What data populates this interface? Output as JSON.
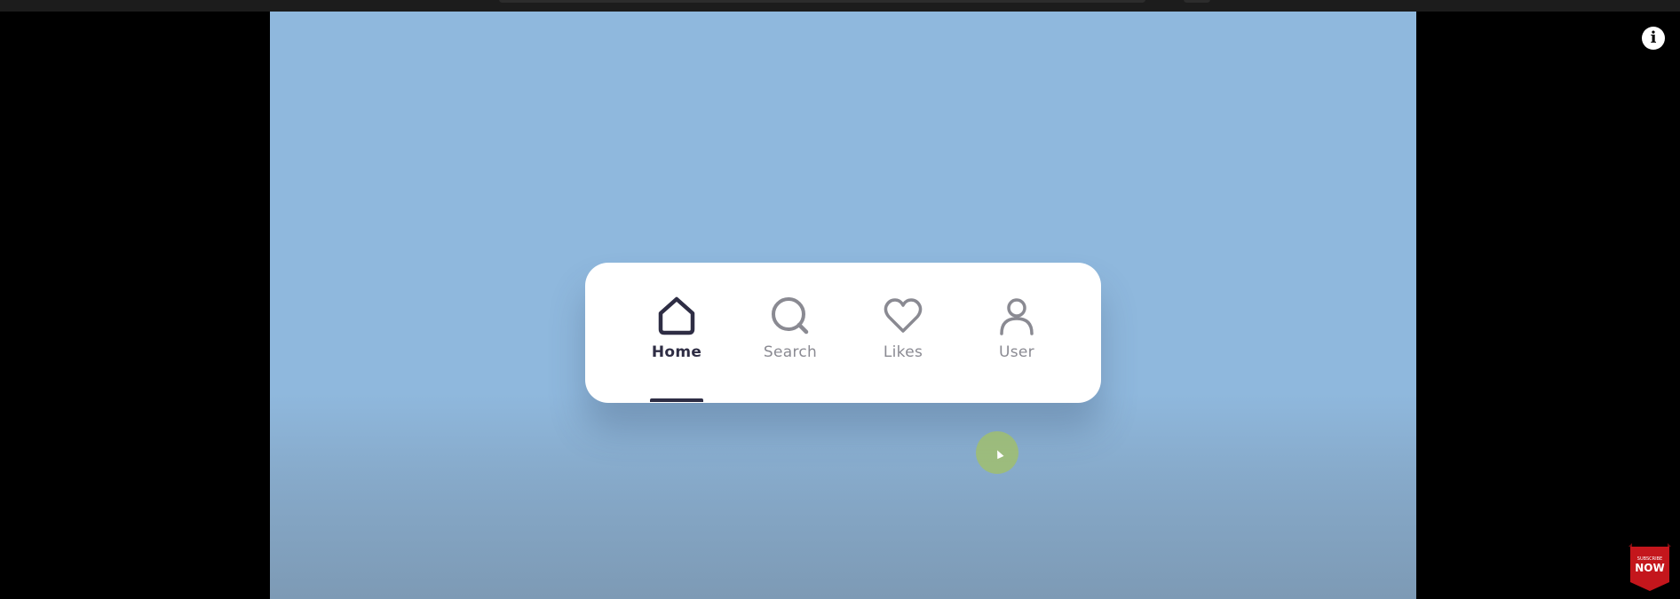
{
  "nav": {
    "items": [
      {
        "label": "Home",
        "icon": "home-icon",
        "active": true
      },
      {
        "label": "Search",
        "icon": "search-icon",
        "active": false
      },
      {
        "label": "Likes",
        "icon": "heart-icon",
        "active": false
      },
      {
        "label": "User",
        "icon": "user-icon",
        "active": false
      }
    ],
    "active_color": "#2e2d44",
    "inactive_color": "#8a8a92"
  },
  "video": {
    "background_color": "#8fb8dd"
  },
  "overlay": {
    "info_icon": "i",
    "subscribe_small": "SUBSCRIBE",
    "subscribe_big": "NOW",
    "subscribe_color": "#c4161c"
  }
}
